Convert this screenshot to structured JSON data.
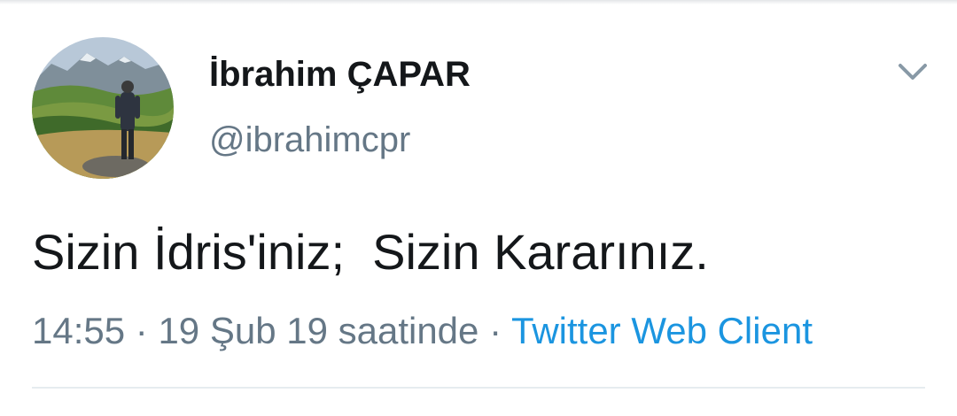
{
  "tweet": {
    "author": {
      "display_name": "İbrahim ÇAPAR",
      "handle": "@ibrahimcpr",
      "avatar_icon": "profile-photo"
    },
    "text": "Sizin İdris'iniz;  Sizin Kararınız.",
    "meta": {
      "time": "14:55",
      "separator": " · ",
      "date_text": "19 Şub 19 saatinde",
      "source": "Twitter Web Client"
    },
    "menu_icon": "chevron-down-icon"
  },
  "colors": {
    "text_primary": "#14171a",
    "text_secondary": "#657786",
    "link": "#1b95e0",
    "divider": "#e6ecf0",
    "chevron": "#8899a6"
  }
}
